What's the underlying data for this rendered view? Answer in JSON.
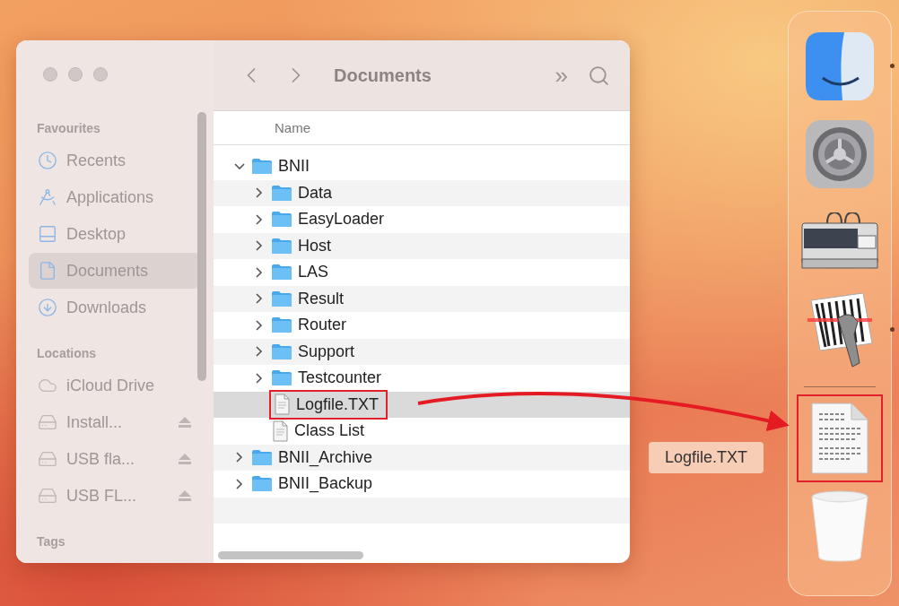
{
  "window": {
    "title": "Documents",
    "toolbar": {
      "overflow": "»"
    },
    "sidebar": {
      "sections": [
        {
          "heading": "Favourites",
          "items": [
            {
              "label": "Recents",
              "kind": "clock",
              "selected": false,
              "ejectable": false
            },
            {
              "label": "Applications",
              "kind": "apps",
              "selected": false,
              "ejectable": false
            },
            {
              "label": "Desktop",
              "kind": "desktop",
              "selected": false,
              "ejectable": false
            },
            {
              "label": "Documents",
              "kind": "document",
              "selected": true,
              "ejectable": false
            },
            {
              "label": "Downloads",
              "kind": "download",
              "selected": false,
              "ejectable": false
            }
          ]
        },
        {
          "heading": "Locations",
          "items": [
            {
              "label": "iCloud Drive",
              "kind": "cloud",
              "selected": false,
              "ejectable": false
            },
            {
              "label": "Install...",
              "kind": "drive",
              "selected": false,
              "ejectable": true
            },
            {
              "label": "USB fla...",
              "kind": "drive",
              "selected": false,
              "ejectable": true
            },
            {
              "label": "USB FL...",
              "kind": "drive",
              "selected": false,
              "ejectable": true
            }
          ]
        },
        {
          "heading": "Tags"
        }
      ]
    },
    "table": {
      "columns": [
        "Name"
      ],
      "rows": [
        {
          "name": "BNII",
          "kind": "folder",
          "expanded": true,
          "selected": false,
          "highlighted": false,
          "children": [
            {
              "name": "Data",
              "kind": "folder",
              "expanded": false,
              "selected": false,
              "highlighted": false
            },
            {
              "name": "EasyLoader",
              "kind": "folder",
              "expanded": false,
              "selected": false,
              "highlighted": false
            },
            {
              "name": "Host",
              "kind": "folder",
              "expanded": false,
              "selected": false,
              "highlighted": false
            },
            {
              "name": "LAS",
              "kind": "folder",
              "expanded": false,
              "selected": false,
              "highlighted": false
            },
            {
              "name": "Result",
              "kind": "folder",
              "expanded": false,
              "selected": false,
              "highlighted": false
            },
            {
              "name": "Router",
              "kind": "folder",
              "expanded": false,
              "selected": false,
              "highlighted": false
            },
            {
              "name": "Support",
              "kind": "folder",
              "expanded": false,
              "selected": false,
              "highlighted": false
            },
            {
              "name": "Testcounter",
              "kind": "folder",
              "expanded": false,
              "selected": false,
              "highlighted": false
            },
            {
              "name": "Logfile.TXT",
              "kind": "file",
              "selected": true,
              "highlighted": true
            },
            {
              "name": "Class List",
              "kind": "file",
              "selected": false,
              "highlighted": false
            }
          ]
        },
        {
          "name": "BNII_Archive",
          "kind": "folder",
          "expanded": false,
          "selected": false,
          "highlighted": false
        },
        {
          "name": "BNII_Backup",
          "kind": "folder",
          "expanded": false,
          "selected": false,
          "highlighted": false
        }
      ]
    }
  },
  "dock": {
    "tooltip": "Logfile.TXT",
    "items": [
      {
        "kind": "finder",
        "running": true,
        "highlighted": false
      },
      {
        "kind": "settings",
        "running": false,
        "highlighted": false
      },
      {
        "kind": "analyzer",
        "running": false,
        "highlighted": false
      },
      {
        "kind": "scanner",
        "running": true,
        "highlighted": false
      },
      {
        "kind": "separator"
      },
      {
        "kind": "document",
        "running": false,
        "highlighted": true
      },
      {
        "kind": "trash",
        "running": false,
        "highlighted": false
      }
    ]
  }
}
